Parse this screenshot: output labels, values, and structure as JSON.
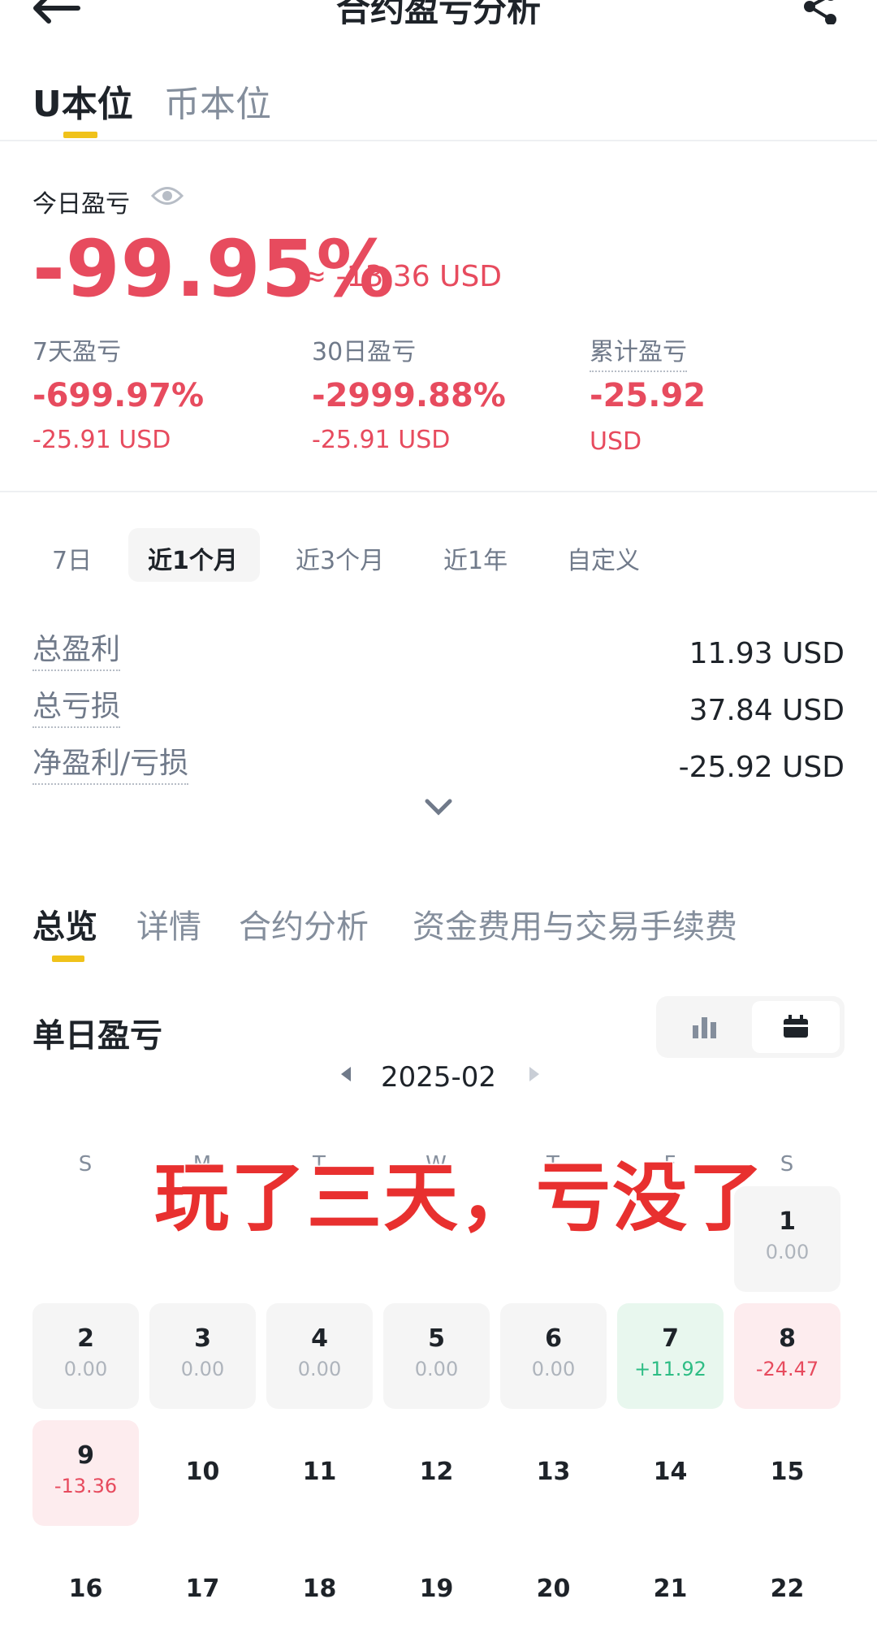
{
  "header": {
    "title": "合约盈亏分析"
  },
  "unit_tabs": [
    {
      "label": "U本位",
      "active": true
    },
    {
      "label": "币本位",
      "active": false
    }
  ],
  "today": {
    "label": "今日盈亏",
    "pct": "-99.95%",
    "usd": "≈ -13.36 USD"
  },
  "stats": [
    {
      "label": "7天盈亏",
      "pct": "-699.97%",
      "usd": "-25.91 USD"
    },
    {
      "label": "30日盈亏",
      "pct": "-2999.88%",
      "usd": "-25.91 USD"
    },
    {
      "label": "累计盈亏",
      "pct": "-25.92",
      "usd": "USD"
    }
  ],
  "ranges": [
    {
      "label": "7日",
      "active": false
    },
    {
      "label": "近1个月",
      "active": true
    },
    {
      "label": "近3个月",
      "active": false
    },
    {
      "label": "近1年",
      "active": false
    },
    {
      "label": "自定义",
      "active": false
    }
  ],
  "summary": [
    {
      "label": "总盈利",
      "value": "11.93 USD"
    },
    {
      "label": "总亏损",
      "value": "37.84 USD"
    },
    {
      "label": "净盈利/亏损",
      "value": "-25.92 USD"
    }
  ],
  "section_tabs": [
    {
      "label": "总览",
      "active": true
    },
    {
      "label": "详情",
      "active": false
    },
    {
      "label": "合约分析",
      "active": false
    },
    {
      "label": "资金费用与交易手续费",
      "active": false
    }
  ],
  "daily": {
    "title": "单日盈亏",
    "month": "2025-02",
    "weekdays": [
      "S",
      "M",
      "T",
      "W",
      "T",
      "F",
      "S"
    ],
    "days": [
      {
        "day": "1",
        "value": "0.00",
        "tone": "neutral"
      },
      {
        "day": "2",
        "value": "0.00",
        "tone": "neutral"
      },
      {
        "day": "3",
        "value": "0.00",
        "tone": "neutral"
      },
      {
        "day": "4",
        "value": "0.00",
        "tone": "neutral"
      },
      {
        "day": "5",
        "value": "0.00",
        "tone": "neutral"
      },
      {
        "day": "6",
        "value": "0.00",
        "tone": "neutral"
      },
      {
        "day": "7",
        "value": "+11.92",
        "tone": "gain"
      },
      {
        "day": "8",
        "value": "-24.47",
        "tone": "loss"
      },
      {
        "day": "9",
        "value": "-13.36",
        "tone": "loss"
      },
      {
        "day": "10"
      },
      {
        "day": "11"
      },
      {
        "day": "12"
      },
      {
        "day": "13"
      },
      {
        "day": "14"
      },
      {
        "day": "15"
      },
      {
        "day": "16"
      },
      {
        "day": "17"
      },
      {
        "day": "18"
      },
      {
        "day": "19"
      },
      {
        "day": "20"
      },
      {
        "day": "21"
      },
      {
        "day": "22"
      }
    ]
  },
  "overlay": {
    "caption": "玩了三天，亏没了"
  },
  "colors": {
    "loss": "#e74b5e",
    "gain": "#2ebd85",
    "accent": "#f0c21a"
  },
  "icons": [
    "back-arrow-icon",
    "share-icon",
    "eye-icon",
    "chevron-down-icon",
    "bar-chart-icon",
    "calendar-icon"
  ]
}
